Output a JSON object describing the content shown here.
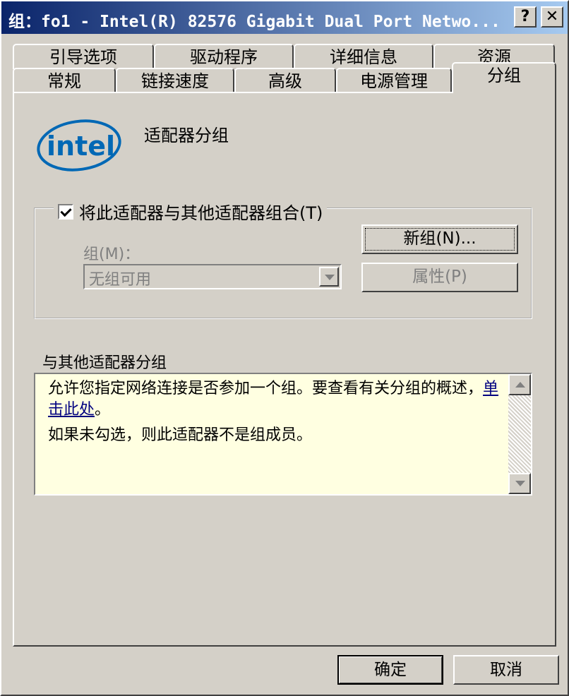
{
  "window": {
    "title": "组：fo1 - Intel(R) 82576 Gigabit Dual Port Netwo...",
    "help_glyph": "?",
    "close_glyph": "✕"
  },
  "tabs": {
    "row_top": [
      "引导选项",
      "驱动程序",
      "详细信息",
      "资源"
    ],
    "row_bottom": [
      "常规",
      "链接速度",
      "高级",
      "电源管理",
      "分组"
    ],
    "active": "分组"
  },
  "page": {
    "logo": "intel",
    "heading": "适配器分组"
  },
  "teaming": {
    "checkbox_label": "将此适配器与其他适配器组合(T)",
    "checked": true,
    "team_label": "组(M)：",
    "team_select_value": "无组可用",
    "new_team_button": "新组(N)...",
    "properties_button": "属性(P)"
  },
  "description": {
    "heading": "与其他适配器分组",
    "line1": "允许您指定网络连接是否参加一个组。要查看有关分组的概述，",
    "link": "单击此处",
    "line1_end": "。",
    "line2": "如果未勾选，则此适配器不是组成员。"
  },
  "footer": {
    "ok_button": "确定",
    "cancel_button": "取消"
  },
  "colors": {
    "titlebar_start": "#0a246a",
    "titlebar_end": "#a6caf0",
    "face": "#d4d0c8",
    "info_background": "#ffffe1",
    "intel_blue": "#0068b5"
  }
}
